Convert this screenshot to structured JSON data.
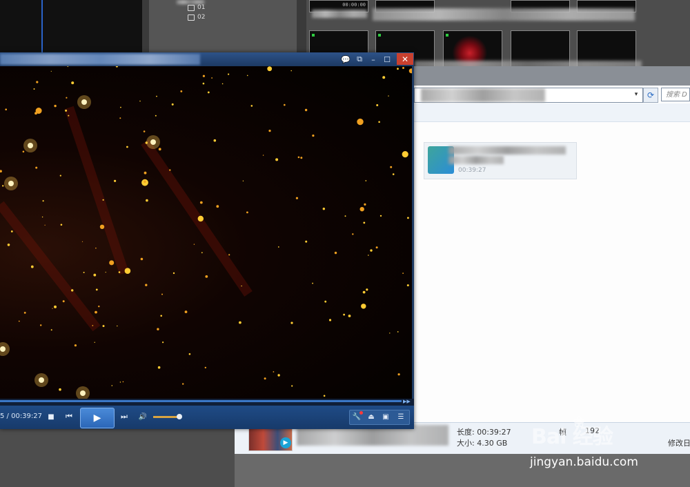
{
  "editor": {
    "tree_items": [
      "01",
      "02"
    ],
    "top_time_label": "00:00:00"
  },
  "explorer": {
    "search_placeholder": "搜索 D",
    "dropdown_glyph": "▾",
    "refresh_glyph": "⟳",
    "file_duration": "00:39:27",
    "details": {
      "duration_label": "长度: 00:39:27",
      "size_label": "大小: 4.30 GB",
      "frame_label": "帧",
      "frame_value": "192",
      "modified_label": "修改日"
    }
  },
  "player": {
    "time": "5 / 00:39:27",
    "title_buttons": {
      "chat": "💬",
      "restore": "⧉",
      "minimize": "–",
      "maximize": "☐",
      "close": "✕"
    },
    "controls": {
      "stop": "■",
      "prev": "⏮",
      "play": "▶",
      "next": "⏭",
      "volume": "🔊",
      "tools": "🔧",
      "eject": "⏏",
      "screen": "▣",
      "playlist": "☰",
      "seek_end": "▶▶"
    },
    "volume_level": 0.9,
    "seek_progress": 0.0
  },
  "watermark": {
    "logo": "Bai  经验",
    "paw": "❀",
    "url": "jingyan.baidu.com"
  },
  "colors": {
    "accent": "#2b67b8",
    "close": "#c9402f",
    "star": "#ffcc33"
  }
}
